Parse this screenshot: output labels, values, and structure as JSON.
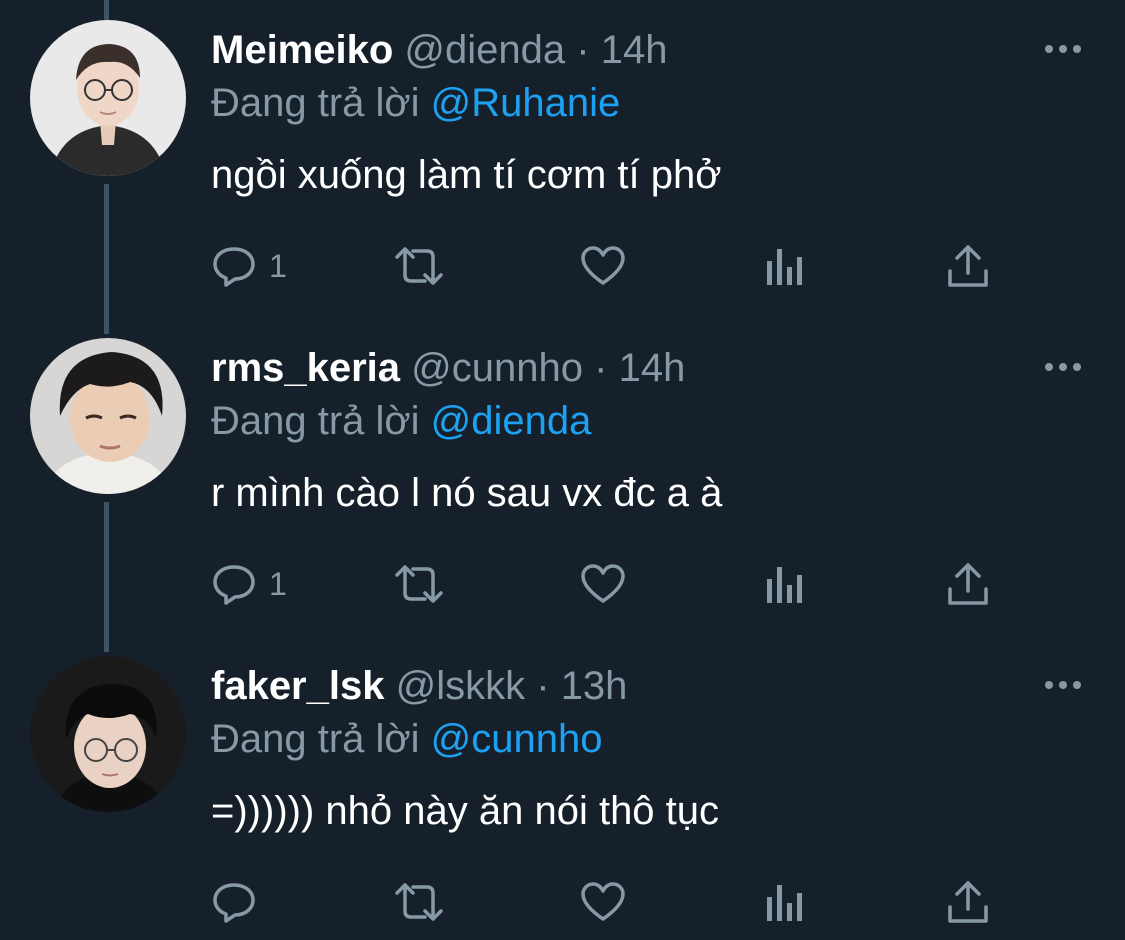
{
  "tweets": [
    {
      "display_name": "Meimeiko",
      "handle": "@dienda",
      "separator": "·",
      "time": "14h",
      "reply_prefix": "Đang trả lời",
      "reply_to": "@Ruhanie",
      "text": "ngồi xuống làm tí cơm tí phở",
      "reply_count": "1",
      "avatar": "avatar-photo"
    },
    {
      "display_name": "rms_keria",
      "handle": "@cunnho",
      "separator": "·",
      "time": "14h",
      "reply_prefix": "Đang trả lời",
      "reply_to": "@dienda",
      "text": "r mình cào l nó sau vx đc a à",
      "reply_count": "1",
      "avatar": "avatar-photo"
    },
    {
      "display_name": "faker_lsk",
      "handle": "@lskkk",
      "separator": "·",
      "time": "13h",
      "reply_prefix": "Đang trả lời",
      "reply_to": "@cunnho",
      "text": "=)))))) nhỏ này ăn nói thô tục",
      "reply_count": "",
      "avatar": "avatar-photo"
    }
  ],
  "icons": {
    "reply": "reply-icon",
    "retweet": "retweet-icon",
    "like": "heart-icon",
    "views": "views-icon",
    "share": "share-icon",
    "more": "more-icon"
  },
  "colors": {
    "background": "#15202b",
    "text": "#ffffff",
    "secondary": "#8899a6",
    "mention": "#1da1f2",
    "thread_line": "#3d5466"
  }
}
